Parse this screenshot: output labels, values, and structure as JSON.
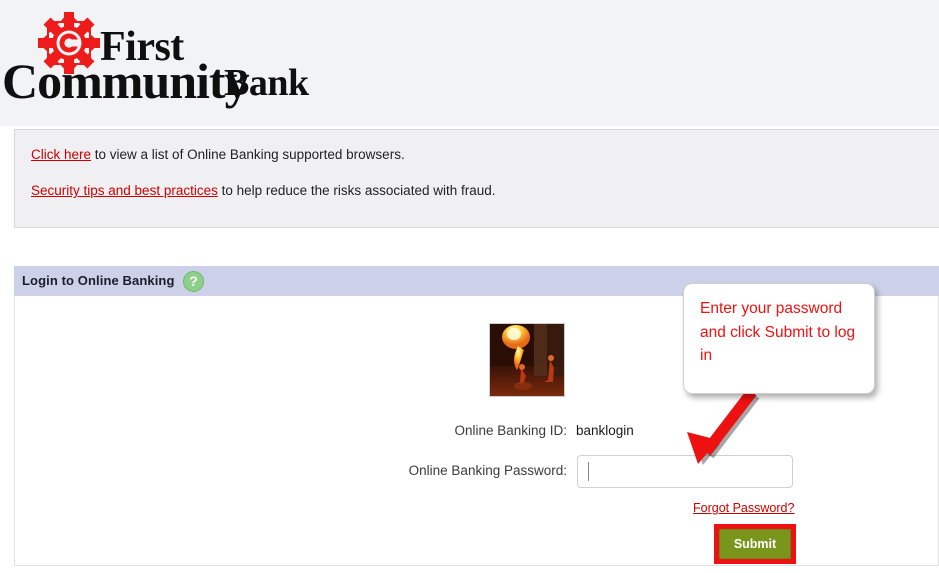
{
  "brand": {
    "logo_icon": "starburst-c-logo-icon",
    "line1": "First",
    "line2": "Community",
    "line3": "Bank",
    "logo_color": "#ee1b1b"
  },
  "notice": {
    "line1_link": "Click here",
    "line1_text": " to view a list of Online Banking supported browsers.",
    "line2_link": "Security tips and best practices",
    "line2_text": " to help reduce the risks associated with fraud.",
    "link_color": "#cc0000",
    "background": "#f0f0f2"
  },
  "login_panel": {
    "header_title": "Login to Online Banking",
    "header_background": "#ccd0e8",
    "help_icon": "question-mark-help-icon",
    "help_icon_glyph": "?",
    "help_icon_color": "#8ed08a",
    "security_image_alt": "fire-breather-security-image",
    "id_label": "Online Banking ID:",
    "id_value": "banklogin",
    "password_label": "Online Banking Password:",
    "password_value": "",
    "password_placeholder": "",
    "forgot_link": "Forgot Password?",
    "submit_label": "Submit",
    "submit_color": "#7a951b",
    "highlight_color": "#ee1111"
  },
  "callout": {
    "text": "Enter your password and click Submit to log in",
    "text_color": "#ee1111",
    "arrow_icon": "red-down-left-arrow-icon"
  }
}
